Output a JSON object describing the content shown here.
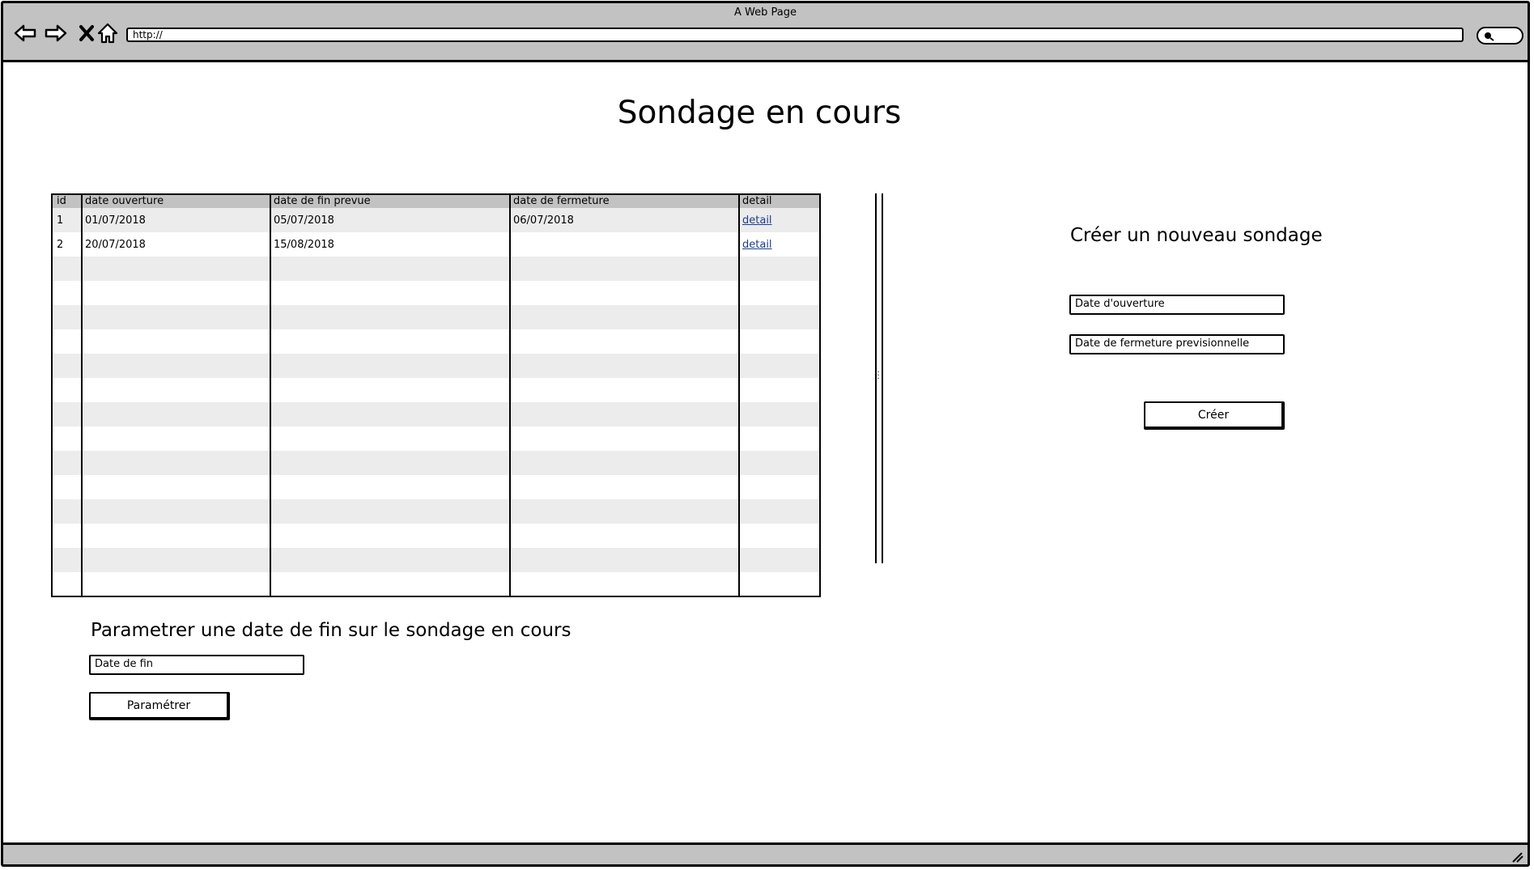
{
  "window": {
    "title": "A Web Page",
    "url": "http://"
  },
  "page": {
    "title": "Sondage en cours"
  },
  "table": {
    "headers": [
      "id",
      "date ouverture",
      "date de fin prevue",
      "date de fermeture",
      "detail"
    ],
    "rows": [
      {
        "id": "1",
        "date_ouverture": "01/07/2018",
        "date_fin_prevue": "05/07/2018",
        "date_fermeture": "06/07/2018",
        "detail": "detail"
      },
      {
        "id": "2",
        "date_ouverture": "20/07/2018",
        "date_fin_prevue": "15/08/2018",
        "date_fermeture": "",
        "detail": "detail"
      }
    ]
  },
  "set_end_date": {
    "heading": "Parametrer une date de fin sur le sondage en cours",
    "date_placeholder": "Date de fin",
    "button_label": "Paramétrer"
  },
  "create_poll": {
    "heading": "Créer un nouveau sondage",
    "open_date_placeholder": "Date d'ouverture",
    "close_date_placeholder": "Date de fermeture previsionnelle",
    "button_label": "Créer"
  }
}
